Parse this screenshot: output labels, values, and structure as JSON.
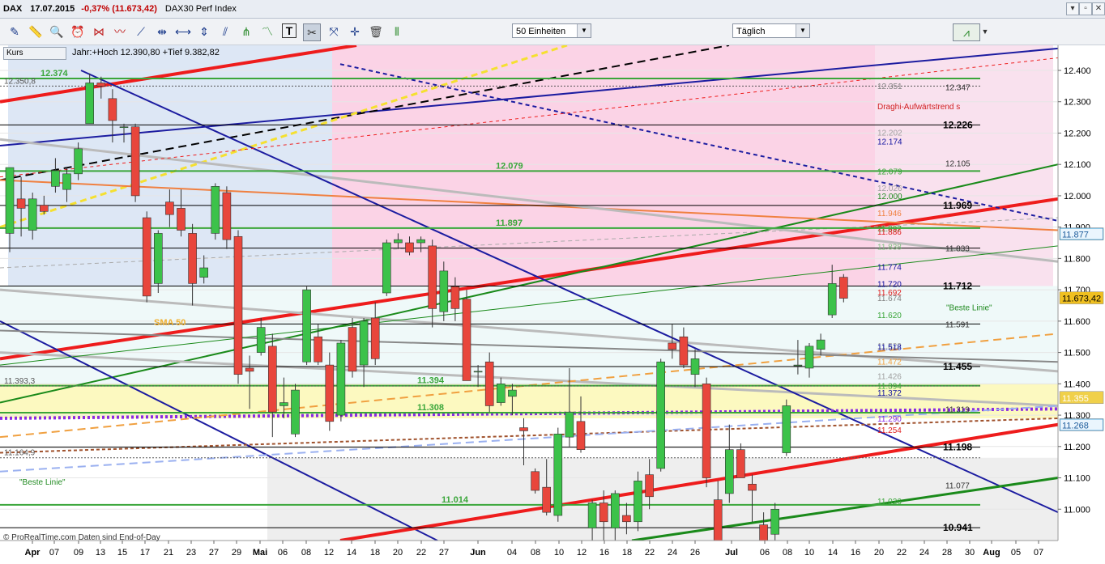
{
  "header": {
    "symbol": "DAX",
    "date": "17.07.2015",
    "change": "-0,37% (11.673,42)",
    "instrument_name": "DAX30 Perf Index",
    "window_buttons": [
      "▾",
      "▫",
      "✕"
    ]
  },
  "toolbar": {
    "icons": [
      "pencil-icon",
      "ruler-icon",
      "zoom-icon",
      "alarm-icon",
      "fibonacci-icon",
      "wave-icon",
      "trendline-icon",
      "horizontal-line-icon",
      "vertical-line-icon",
      "channel-icon",
      "pitchfork-icon",
      "text-icon",
      "tools-icon",
      "cursor-icon",
      "crosshair-icon",
      "trash-icon",
      "indicator-icon"
    ],
    "units_select": "50 Einheiten",
    "period_select": "Täglich"
  },
  "panel": {
    "kurs_label": "Kurs",
    "range_info": "Jahr:+Hoch 12.390,80 +Tief 9.382,82",
    "credit": "© ProRealTime.com  Daten sind End-of-Day"
  },
  "colors": {
    "up": "#3cc24a",
    "down": "#e8463c",
    "pink_zone": "#fbd3e6",
    "blue_zone": "#dde7f5",
    "yellow_zone": "#fbf7b0"
  },
  "chart_data": {
    "type": "candlestick",
    "ylim": [
      10900,
      12480
    ],
    "y_ticks": [
      11000,
      11100,
      11200,
      11300,
      11400,
      11500,
      11600,
      11700,
      11800,
      11900,
      12000,
      12100,
      12200,
      12300,
      12400
    ],
    "y_tick_labels": [
      "11.000",
      "11.100",
      "11.200",
      "11.300",
      "11.400",
      "11.500",
      "11.600",
      "11.700",
      "11.800",
      "11.900",
      "12.000",
      "12.100",
      "12.200",
      "12.300",
      "12.400"
    ],
    "x_labels": [
      "Apr",
      "07",
      "09",
      "13",
      "15",
      "17",
      "21",
      "23",
      "27",
      "29",
      "Mai",
      "06",
      "08",
      "12",
      "14",
      "18",
      "20",
      "22",
      "27",
      "Jun",
      "04",
      "08",
      "10",
      "12",
      "16",
      "18",
      "22",
      "24",
      "26",
      "Jul",
      "06",
      "08",
      "10",
      "14",
      "16",
      "20",
      "22",
      "24",
      "28",
      "30",
      "Aug",
      "05",
      "07"
    ],
    "candles": [
      {
        "d": "01.04",
        "o": 11880,
        "h": 12090,
        "l": 11820,
        "c": 12090
      },
      {
        "d": "02.04",
        "o": 11990,
        "h": 12060,
        "l": 11870,
        "c": 11960
      },
      {
        "d": "07.04",
        "o": 11890,
        "h": 12010,
        "l": 11860,
        "c": 11990
      },
      {
        "d": "08.04",
        "o": 11970,
        "h": 12000,
        "l": 11940,
        "c": 11950
      },
      {
        "d": "09.04",
        "o": 12030,
        "h": 12120,
        "l": 12010,
        "c": 12080
      },
      {
        "d": "10.04",
        "o": 12020,
        "h": 12090,
        "l": 11980,
        "c": 12070
      },
      {
        "d": "13.04",
        "o": 12070,
        "h": 12170,
        "l": 12050,
        "c": 12150
      },
      {
        "d": "14.04",
        "o": 12230,
        "h": 12390,
        "l": 12230,
        "c": 12360
      },
      {
        "d": "15.04",
        "o": 12360,
        "h": 12380,
        "l": 12310,
        "c": 12350
      },
      {
        "d": "16.04",
        "o": 12310,
        "h": 12340,
        "l": 12170,
        "c": 12240
      },
      {
        "d": "17.04",
        "o": 12220,
        "h": 12230,
        "l": 12170,
        "c": 12220
      },
      {
        "d": "20.04",
        "o": 12220,
        "h": 12230,
        "l": 11980,
        "c": 12000
      },
      {
        "d": "21.04",
        "o": 11930,
        "h": 11950,
        "l": 11660,
        "c": 11680
      },
      {
        "d": "22.04",
        "o": 11720,
        "h": 11890,
        "l": 11690,
        "c": 11880
      },
      {
        "d": "23.04",
        "o": 11980,
        "h": 12020,
        "l": 11900,
        "c": 11940
      },
      {
        "d": "24.04",
        "o": 11960,
        "h": 12020,
        "l": 11870,
        "c": 11890
      },
      {
        "d": "27.04",
        "o": 11880,
        "h": 11910,
        "l": 11650,
        "c": 11720
      },
      {
        "d": "28.04",
        "o": 11740,
        "h": 11810,
        "l": 11720,
        "c": 11770
      },
      {
        "d": "29.04",
        "o": 11880,
        "h": 12040,
        "l": 11860,
        "c": 12030
      },
      {
        "d": "30.04",
        "o": 12010,
        "h": 12030,
        "l": 11830,
        "c": 11860
      },
      {
        "d": "04.05",
        "o": 11870,
        "h": 11890,
        "l": 11400,
        "c": 11430
      },
      {
        "d": "05.05",
        "o": 11450,
        "h": 11490,
        "l": 11320,
        "c": 11440
      },
      {
        "d": "06.05",
        "o": 11500,
        "h": 11610,
        "l": 11490,
        "c": 11580
      },
      {
        "d": "07.05",
        "o": 11520,
        "h": 11560,
        "l": 11230,
        "c": 11310
      },
      {
        "d": "08.05",
        "o": 11330,
        "h": 11420,
        "l": 11290,
        "c": 11340
      },
      {
        "d": "11.05",
        "o": 11240,
        "h": 11400,
        "l": 11230,
        "c": 11380
      },
      {
        "d": "12.05",
        "o": 11470,
        "h": 11710,
        "l": 11460,
        "c": 11700
      },
      {
        "d": "13.05",
        "o": 11550,
        "h": 11590,
        "l": 11460,
        "c": 11470
      },
      {
        "d": "14.05",
        "o": 11460,
        "h": 11500,
        "l": 11250,
        "c": 11280
      },
      {
        "d": "15.05",
        "o": 11300,
        "h": 11540,
        "l": 11280,
        "c": 11530
      },
      {
        "d": "18.05",
        "o": 11580,
        "h": 11610,
        "l": 11420,
        "c": 11440
      },
      {
        "d": "19.05",
        "o": 11460,
        "h": 11610,
        "l": 11390,
        "c": 11600
      },
      {
        "d": "20.05",
        "o": 11610,
        "h": 11660,
        "l": 11460,
        "c": 11480
      },
      {
        "d": "21.05",
        "o": 11690,
        "h": 11860,
        "l": 11680,
        "c": 11850
      },
      {
        "d": "22.05",
        "o": 11850,
        "h": 11880,
        "l": 11830,
        "c": 11860
      },
      {
        "d": "26.05",
        "o": 11850,
        "h": 11870,
        "l": 11810,
        "c": 11820
      },
      {
        "d": "27.05",
        "o": 11850,
        "h": 11870,
        "l": 11820,
        "c": 11860
      },
      {
        "d": "28.05",
        "o": 11840,
        "h": 11860,
        "l": 11580,
        "c": 11640
      },
      {
        "d": "29.05",
        "o": 11630,
        "h": 11790,
        "l": 11600,
        "c": 11760
      },
      {
        "d": "01.06",
        "o": 11710,
        "h": 11740,
        "l": 11600,
        "c": 11640
      },
      {
        "d": "02.06",
        "o": 11670,
        "h": 11700,
        "l": 11410,
        "c": 11410
      },
      {
        "d": "03.06",
        "o": 11440,
        "h": 11460,
        "l": 11390,
        "c": 11440
      },
      {
        "d": "04.06",
        "o": 11470,
        "h": 11500,
        "l": 11310,
        "c": 11330
      },
      {
        "d": "05.06",
        "o": 11340,
        "h": 11420,
        "l": 11330,
        "c": 11400
      },
      {
        "d": "08.06",
        "o": 11360,
        "h": 11400,
        "l": 11300,
        "c": 11380
      },
      {
        "d": "09.06",
        "o": 11260,
        "h": 11290,
        "l": 11140,
        "c": 11250
      },
      {
        "d": "10.06",
        "o": 11120,
        "h": 11130,
        "l": 11050,
        "c": 11060
      },
      {
        "d": "11.06",
        "o": 11070,
        "h": 11160,
        "l": 10980,
        "c": 10990
      },
      {
        "d": "12.06",
        "o": 10980,
        "h": 11260,
        "l": 10960,
        "c": 11240
      },
      {
        "d": "15.06",
        "o": 11230,
        "h": 11450,
        "l": 11200,
        "c": 11310
      },
      {
        "d": "16.06",
        "o": 11280,
        "h": 11360,
        "l": 11180,
        "c": 11190
      },
      {
        "d": "17.06",
        "o": 10940,
        "h": 11030,
        "l": 10880,
        "c": 11020
      },
      {
        "d": "18.06",
        "o": 11020,
        "h": 11060,
        "l": 10900,
        "c": 10960
      },
      {
        "d": "19.06",
        "o": 10940,
        "h": 11060,
        "l": 10900,
        "c": 11050
      },
      {
        "d": "22.06",
        "o": 10980,
        "h": 11020,
        "l": 10920,
        "c": 10960
      },
      {
        "d": "23.06",
        "o": 10960,
        "h": 11120,
        "l": 10930,
        "c": 11090
      },
      {
        "d": "24.06",
        "o": 11110,
        "h": 11160,
        "l": 11000,
        "c": 11040
      },
      {
        "d": "25.06",
        "o": 11130,
        "h": 11480,
        "l": 11120,
        "c": 11470
      },
      {
        "d": "26.06",
        "o": 11530,
        "h": 11590,
        "l": 11480,
        "c": 11510
      },
      {
        "d": "29.06",
        "o": 11550,
        "h": 11580,
        "l": 11450,
        "c": 11460
      },
      {
        "d": "30.06",
        "o": 11430,
        "h": 11510,
        "l": 11390,
        "c": 11480
      },
      {
        "d": "01.07",
        "o": 11400,
        "h": 11420,
        "l": 11070,
        "c": 11100
      },
      {
        "d": "02.07",
        "o": 11030,
        "h": 11090,
        "l": 10880,
        "c": 10900
      },
      {
        "d": "03.07",
        "o": 11050,
        "h": 11270,
        "l": 11020,
        "c": 11190
      },
      {
        "d": "06.07",
        "o": 11190,
        "h": 11210,
        "l": 11100,
        "c": 11100
      },
      {
        "d": "07.07",
        "o": 11080,
        "h": 11110,
        "l": 10960,
        "c": 11060
      },
      {
        "d": "08.07",
        "o": 10950,
        "h": 10990,
        "l": 10880,
        "c": 10900
      },
      {
        "d": "09.07",
        "o": 10920,
        "h": 11020,
        "l": 10900,
        "c": 11000
      },
      {
        "d": "10.07",
        "o": 11180,
        "h": 11350,
        "l": 11170,
        "c": 11330
      },
      {
        "d": "13.07",
        "o": 11460,
        "h": 11540,
        "l": 11430,
        "c": 11460
      },
      {
        "d": "14.07",
        "o": 11450,
        "h": 11530,
        "l": 11420,
        "c": 11520
      },
      {
        "d": "15.07",
        "o": 11510,
        "h": 11560,
        "l": 11490,
        "c": 11540
      },
      {
        "d": "16.07",
        "o": 11620,
        "h": 11780,
        "l": 11610,
        "c": 11720
      },
      {
        "d": "17.07",
        "o": 11740,
        "h": 11750,
        "l": 11660,
        "c": 11673
      }
    ],
    "current_price_label": "11.673,42",
    "price_tags": [
      {
        "v": 11877,
        "t": "11.877",
        "c": "#45a6d8"
      },
      {
        "v": 11673,
        "t": "11.673,42",
        "c": "#f0c020"
      },
      {
        "v": 11355,
        "t": "11.355",
        "c": "#f0d04a"
      },
      {
        "v": 11268,
        "t": "11.268",
        "c": "#4aa8e0"
      }
    ],
    "horizontal_levels": [
      {
        "v": 12374,
        "t": "12.374",
        "c": "#3aa63a",
        "lt": "12.374"
      },
      {
        "v": 12350,
        "t": "12.350,8",
        "c": "#555555"
      },
      {
        "v": 12226,
        "t": "12.226",
        "c": "#000000"
      },
      {
        "v": 12079,
        "t": "12.079",
        "c": "#3aa63a",
        "lt": "12.079"
      },
      {
        "v": 11969,
        "t": "11.969",
        "c": "#000000"
      },
      {
        "v": 11897,
        "t": "11.897",
        "c": "#3aa63a",
        "lt": "11.897"
      },
      {
        "v": 11833,
        "t": "11.833",
        "c": "#000000"
      },
      {
        "v": 11712,
        "t": "11.712",
        "c": "#000000"
      },
      {
        "v": 11591,
        "t": "11.591",
        "c": "#000000"
      },
      {
        "v": 11455,
        "t": "11.455",
        "c": "#000000"
      },
      {
        "v": 11394,
        "t": "11.394",
        "c": "#3aa63a",
        "lt": "11.394"
      },
      {
        "v": 11393,
        "t": "11.393,3",
        "c": "#555555"
      },
      {
        "v": 11308,
        "t": "11.308",
        "c": "#3aa63a",
        "lt": "11.308"
      },
      {
        "v": 11198,
        "t": "11.198",
        "c": "#000000"
      },
      {
        "v": 11164,
        "t": "11.164,9",
        "c": "#555555"
      },
      {
        "v": 11014,
        "t": "11.014",
        "c": "#3aa63a",
        "lt": "11.014"
      },
      {
        "v": 10941,
        "t": "10.941",
        "c": "#000000"
      }
    ],
    "right_labels": [
      {
        "v": 12351,
        "t": "12.351",
        "c": "#808080"
      },
      {
        "v": 12347,
        "t": "12.347",
        "c": "#333333"
      },
      {
        "v": 12287,
        "t": "Draghi-Aufwärtstrend s",
        "c": "#d02020"
      },
      {
        "v": 12226,
        "t": "12.226",
        "c": "#000000",
        "b": true
      },
      {
        "v": 12202,
        "t": "12.202",
        "c": "#a0a0a0"
      },
      {
        "v": 12174,
        "t": "12.174",
        "c": "#1010a0"
      },
      {
        "v": 12105,
        "t": "12.105",
        "c": "#333333"
      },
      {
        "v": 12079,
        "t": "12.079",
        "c": "#3aa63a"
      },
      {
        "v": 12026,
        "t": "12.026",
        "c": "#a0a0a0"
      },
      {
        "v": 12000,
        "t": "12.000",
        "c": "#228b22"
      },
      {
        "v": 11969,
        "t": "11.969",
        "c": "#000000",
        "b": true
      },
      {
        "v": 11946,
        "t": "11.946",
        "c": "#f08040"
      },
      {
        "v": 11897,
        "t": "11.897",
        "c": "#3aa63a"
      },
      {
        "v": 11886,
        "t": "11.886",
        "c": "#e02020"
      },
      {
        "v": 11838,
        "t": "11.838",
        "c": "#80c080"
      },
      {
        "v": 11833,
        "t": "11.833",
        "c": "#333333"
      },
      {
        "v": 11774,
        "t": "11.774",
        "c": "#1010a0"
      },
      {
        "v": 11720,
        "t": "11.720",
        "c": "#1010a0"
      },
      {
        "v": 11712,
        "t": "11.712",
        "c": "#000000",
        "b": true
      },
      {
        "v": 11692,
        "t": "11.692",
        "c": "#e02020"
      },
      {
        "v": 11674,
        "t": "11.674",
        "c": "#808080"
      },
      {
        "v": 11645,
        "t": "\"Beste Linie\"",
        "c": "#228b22"
      },
      {
        "v": 11620,
        "t": "11.620",
        "c": "#3aa63a"
      },
      {
        "v": 11591,
        "t": "11.591",
        "c": "#333333"
      },
      {
        "v": 11522,
        "t": "11.522",
        "c": "#a0a0a0"
      },
      {
        "v": 11518,
        "t": "11.518",
        "c": "#1010a0"
      },
      {
        "v": 11472,
        "t": "11.472",
        "c": "#f0a040"
      },
      {
        "v": 11455,
        "t": "11.455",
        "c": "#000000",
        "b": true
      },
      {
        "v": 11426,
        "t": "11.426",
        "c": "#a0a0a0"
      },
      {
        "v": 11394,
        "t": "11.394",
        "c": "#3aa63a"
      },
      {
        "v": 11372,
        "t": "11.372",
        "c": "#1010a0"
      },
      {
        "v": 11319,
        "t": "11.319",
        "c": "#333333"
      },
      {
        "v": 11290,
        "t": "11.290",
        "c": "#8a2be2"
      },
      {
        "v": 11254,
        "t": "11.254",
        "c": "#e02020"
      },
      {
        "v": 11198,
        "t": "11.198",
        "c": "#000000",
        "b": true
      },
      {
        "v": 11077,
        "t": "11.077",
        "c": "#333333"
      },
      {
        "v": 11026,
        "t": "11.026",
        "c": "#3aa63a"
      },
      {
        "v": 10941,
        "t": "10.941",
        "c": "#000000",
        "b": true
      }
    ],
    "annotations": [
      {
        "t": "SMA 50",
        "c": "#f0b030"
      },
      {
        "t": "\"Beste Linie\"",
        "c": "#228b22"
      }
    ]
  }
}
